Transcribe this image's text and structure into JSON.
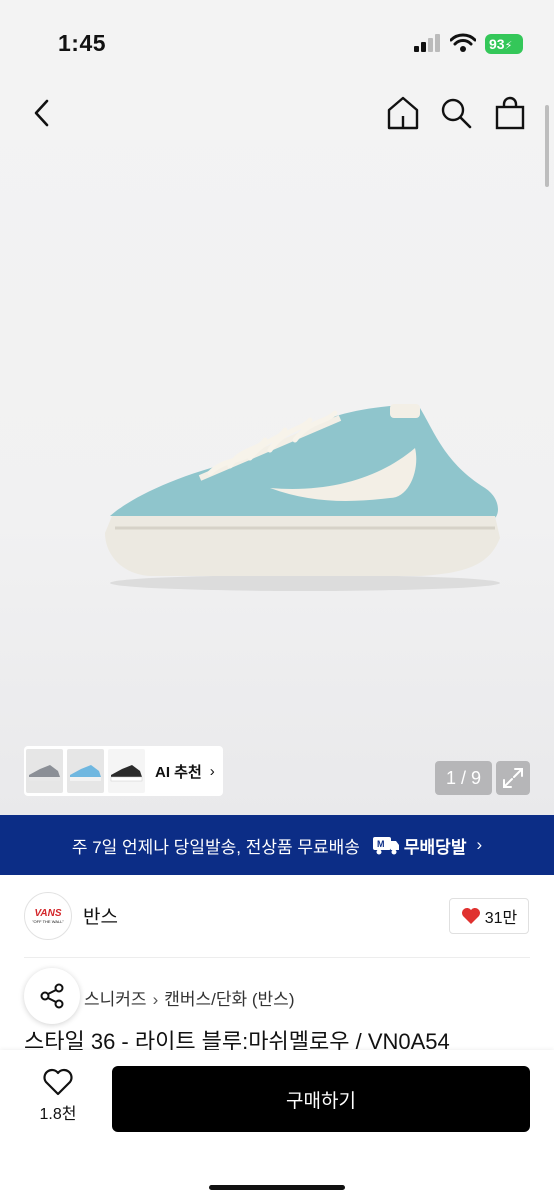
{
  "status": {
    "time": "1:45",
    "battery": "93"
  },
  "nav": {
    "back_icon": "chevron-left-icon",
    "home_icon": "home-icon",
    "search_icon": "search-icon",
    "bag_icon": "shopping-bag-icon"
  },
  "gallery": {
    "ai_label": "AI 추천",
    "page_counter": "1 / 9"
  },
  "banner": {
    "text": "주 7일 언제나 당일발송, 전상품 무료배송",
    "badge": "무배당발"
  },
  "brand": {
    "name": "반스",
    "logo_text": "VANS",
    "logo_sub": "\"OFF THE WALL\"",
    "likes": "31만"
  },
  "breadcrumb": {
    "level1": "스니커즈",
    "level2": "캔버스/단화 (반스)"
  },
  "product": {
    "title": "스타일 36 - 라이트 블루:마쉬멜로우 / VN0A54"
  },
  "bottom": {
    "wish_count": "1.8천",
    "buy_label": "구매하기"
  },
  "colors": {
    "banner": "#0c2d86",
    "heart": "#e0312f",
    "battery": "#34c759"
  }
}
